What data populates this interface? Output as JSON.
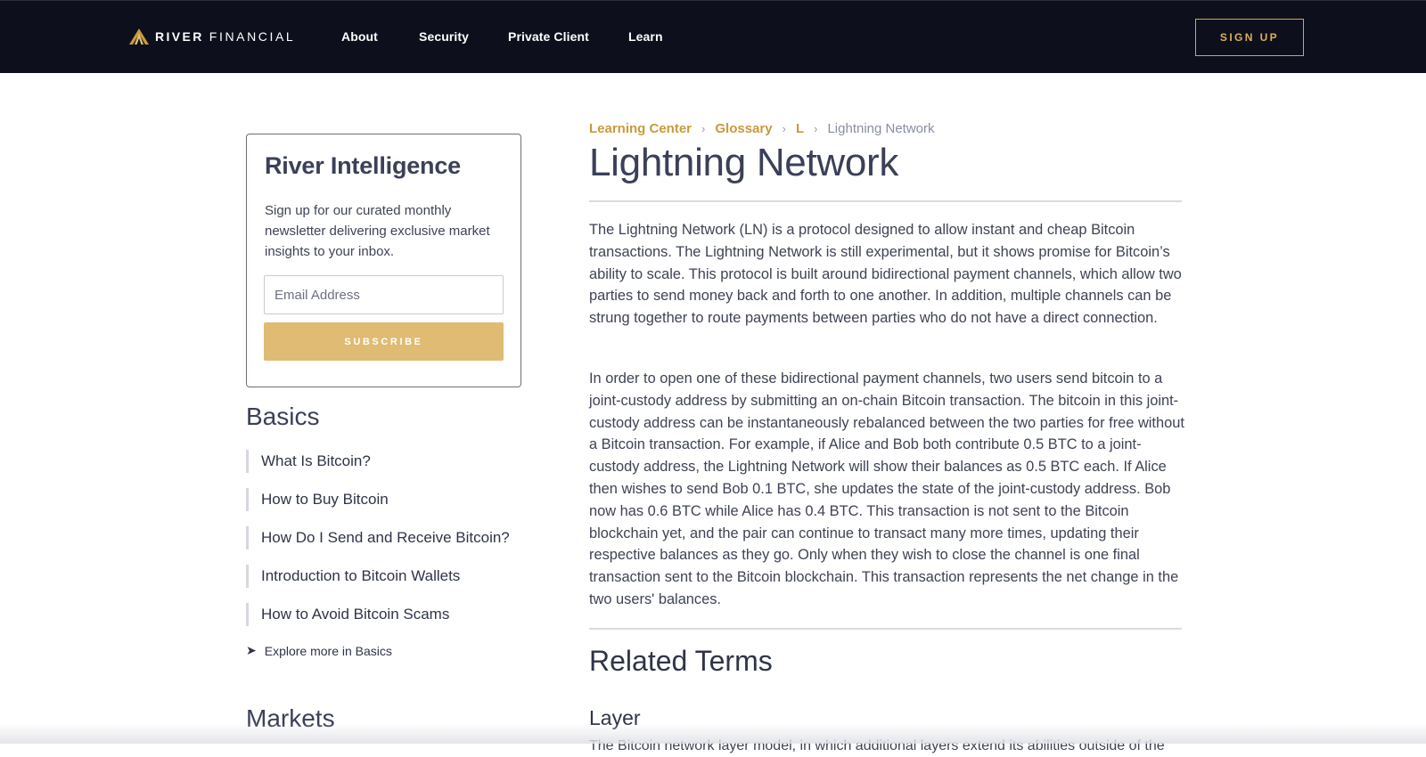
{
  "header": {
    "brand_strong": "RIVER",
    "brand_light": "FINANCIAL",
    "nav": [
      "About",
      "Security",
      "Private Client",
      "Learn"
    ],
    "signup_label": "SIGN UP"
  },
  "sidebar": {
    "newsletter": {
      "title": "River Intelligence",
      "description": "Sign up for our curated monthly newsletter delivering exclusive market insights to your inbox.",
      "email_placeholder": "Email Address",
      "subscribe_label": "SUBSCRIBE"
    },
    "basics": {
      "heading": "Basics",
      "items": [
        "What Is Bitcoin?",
        "How to Buy Bitcoin",
        "How Do I Send and Receive Bitcoin?",
        "Introduction to Bitcoin Wallets",
        "How to Avoid Bitcoin Scams"
      ],
      "explore_label": "Explore more in Basics"
    },
    "markets": {
      "heading": "Markets"
    }
  },
  "main": {
    "breadcrumb": {
      "items": [
        "Learning Center",
        "Glossary",
        "L"
      ],
      "current": "Lightning Network",
      "separator": "›"
    },
    "title": "Lightning Network",
    "paragraphs": [
      "The Lightning Network (LN) is a protocol designed to allow instant and cheap Bitcoin transactions. The Lightning Network is still experimental, but it shows promise for Bitcoin’s ability to scale. This protocol is built around bidirectional payment channels, which allow two parties to send money back and forth to one another. In addition, multiple channels can be strung together to route payments between parties who do not have a direct connection.",
      "In order to open one of these bidirectional payment channels, two users send bitcoin to a joint-custody address by submitting an on-chain Bitcoin transaction. The bitcoin in this joint-custody address can be instantaneously rebalanced between the two parties for free without a Bitcoin transaction. For example, if Alice and Bob both contribute 0.5 BTC to a joint-custody address, the Lightning Network will show their balances as 0.5 BTC each. If Alice then wishes to send Bob 0.1 BTC, she updates the state of the joint-custody address. Bob now has 0.6 BTC while Alice has 0.4 BTC. This transaction is not sent to the Bitcoin blockchain yet, and the pair can continue to transact many more times, updating their respective balances as they go. Only when they wish to close the channel is one final transaction sent to the Bitcoin blockchain. This transaction represents the net change in the two users' balances."
    ],
    "related_heading": "Related Terms",
    "related_terms": [
      {
        "title": "Layer",
        "snippet": "The Bitcoin network layer model, in which additional layers extend its abilities outside of the"
      }
    ]
  },
  "colors": {
    "header_bg": "#0d0f1c",
    "accent_gold": "#d1a84f",
    "subscribe_bg": "#dfbb73",
    "heading_text": "#3b4058"
  }
}
